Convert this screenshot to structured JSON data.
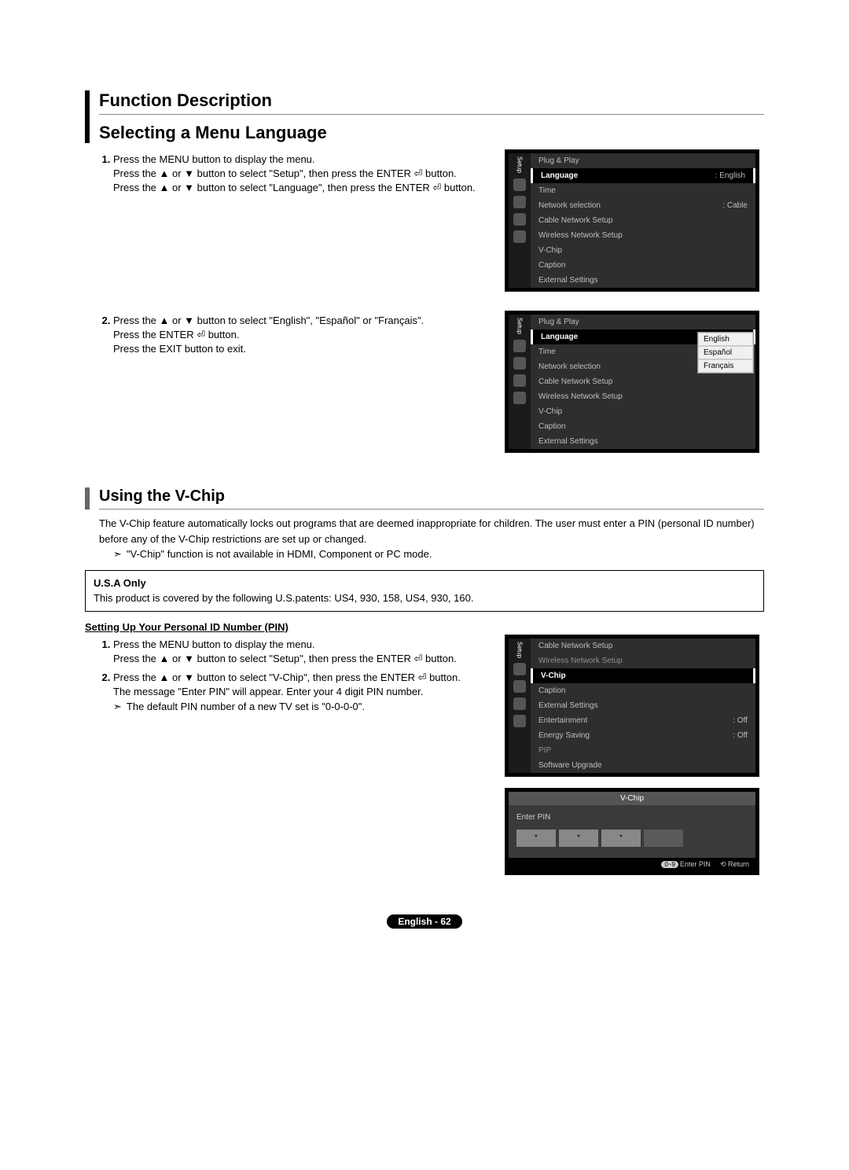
{
  "page_heading": "Function Description",
  "section1": {
    "title": "Selecting a Menu Language",
    "step1": "Press the MENU button to display the menu.\nPress the ▲ or ▼ button to select \"Setup\", then press the ENTER ⏎ button.\nPress the ▲ or ▼ button to select \"Language\", then press the ENTER ⏎ button.",
    "step2_a": "Press the ▲ or ▼ button to select \"English\", \"Español\" or \"Français\".",
    "step2_b": "Press the ENTER ⏎ button.",
    "step2_c": "Press the EXIT button to exit."
  },
  "tv1": {
    "side_label": "Setup",
    "items": [
      {
        "label": "Plug & Play",
        "val": ""
      },
      {
        "label": "Language",
        "val": ": English",
        "active": true
      },
      {
        "label": "Time",
        "val": ""
      },
      {
        "label": "Network selection",
        "val": ": Cable"
      },
      {
        "label": "Cable Network Setup",
        "val": ""
      },
      {
        "label": "Wireless Network Setup",
        "val": ""
      },
      {
        "label": "V-Chip",
        "val": ""
      },
      {
        "label": "Caption",
        "val": ""
      },
      {
        "label": "External Settings",
        "val": ""
      }
    ]
  },
  "tv2": {
    "side_label": "Setup",
    "items": [
      {
        "label": "Plug & Play",
        "val": ""
      },
      {
        "label": "Language",
        "val": "",
        "active": true
      },
      {
        "label": "Time",
        "val": ""
      },
      {
        "label": "Network selection",
        "val": ""
      },
      {
        "label": "Cable Network Setup",
        "val": ""
      },
      {
        "label": "Wireless Network Setup",
        "val": ""
      },
      {
        "label": "V-Chip",
        "val": ""
      },
      {
        "label": "Caption",
        "val": ""
      },
      {
        "label": "External Settings",
        "val": ""
      }
    ],
    "dropdown": [
      "English",
      "Español",
      "Français"
    ]
  },
  "section2": {
    "title": "Using the V-Chip",
    "intro": "The V-Chip feature automatically locks out programs that are deemed inappropriate for children. The user must enter a PIN (personal ID number) before any of the V-Chip restrictions are set up or changed.",
    "note": "\"V-Chip\" function is not available in HDMI, Component or PC mode.",
    "usa_title": "U.S.A Only",
    "usa_body": "This product is covered by the following U.S.patents: US4, 930, 158, US4, 930, 160.",
    "subhead": "Setting Up Your Personal ID Number (PIN)",
    "step1": "Press the MENU button to display the menu.\nPress the ▲ or ▼ button to select \"Setup\", then press the ENTER ⏎ button.",
    "step2_a": "Press the ▲ or ▼ button to select \"V-Chip\", then press the ENTER ⏎ button.",
    "step2_b": "The message \"Enter PIN\" will appear. Enter your 4 digit PIN number.",
    "step2_note": "The default PIN number of a new TV set is \"0-0-0-0\"."
  },
  "tv3": {
    "side_label": "Setup",
    "items": [
      {
        "label": "Cable Network Setup",
        "val": ""
      },
      {
        "label": "Wireless Network Setup",
        "val": "",
        "dim": true
      },
      {
        "label": "V-Chip",
        "val": "",
        "active": true
      },
      {
        "label": "Caption",
        "val": ""
      },
      {
        "label": "External Settings",
        "val": ""
      },
      {
        "label": "Entertainment",
        "val": ": Off"
      },
      {
        "label": "Energy Saving",
        "val": ": Off"
      },
      {
        "label": "PIP",
        "val": "",
        "dim": true
      },
      {
        "label": "Software Upgrade",
        "val": ""
      }
    ]
  },
  "tv_pin": {
    "title": "V-Chip",
    "label": "Enter PIN",
    "stars": [
      "*",
      "*",
      "*",
      ""
    ],
    "footer_enter": "Enter PIN",
    "footer_key": "0~9",
    "footer_return": "Return"
  },
  "footer": "English - 62"
}
